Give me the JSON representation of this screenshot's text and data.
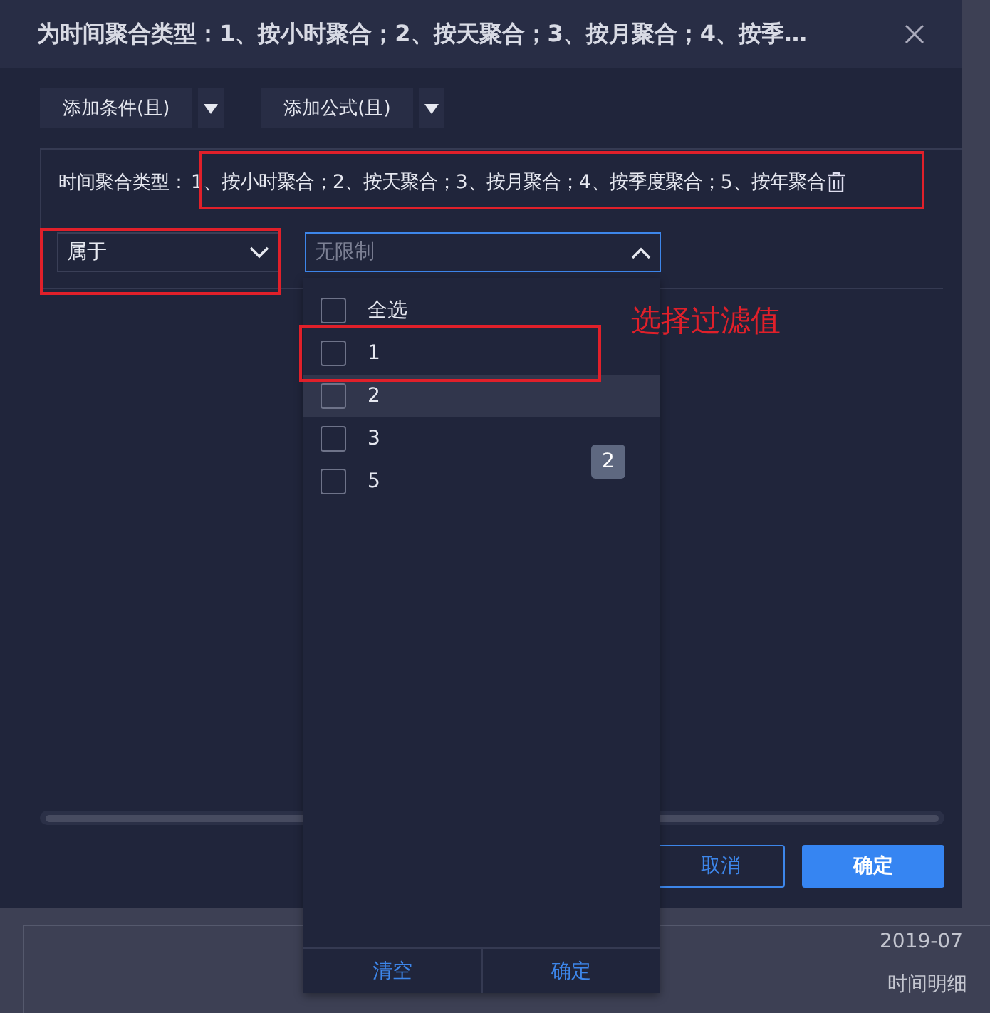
{
  "dialog": {
    "title": "为时间聚合类型：1、按小时聚合；2、按天聚合；3、按月聚合；4、按季…",
    "add_buttons": [
      {
        "label": "添加条件(且)"
      },
      {
        "label": "添加公式(且)"
      }
    ],
    "condition": {
      "label": "时间聚合类型：",
      "value": "1、按小时聚合；2、按天聚合；3、按月聚合；4、按季度聚合；5、按年聚合",
      "operator": "属于",
      "value_placeholder": "无限制",
      "expanded": true
    },
    "buttons": [
      {
        "label": "取消",
        "kind": "secondary"
      },
      {
        "label": "确定",
        "kind": "primary"
      }
    ]
  },
  "dropdown": {
    "options": [
      {
        "label": "全选",
        "checked": false,
        "highlighted": false
      },
      {
        "label": "1",
        "checked": false,
        "highlighted": false
      },
      {
        "label": "2",
        "checked": false,
        "highlighted": true
      },
      {
        "label": "3",
        "checked": false,
        "highlighted": false
      },
      {
        "label": "5",
        "checked": false,
        "highlighted": false
      }
    ],
    "badge": "2",
    "footer": [
      "清空",
      "确定"
    ]
  },
  "annotation": "选择过滤值",
  "background": {
    "date": "2019-07",
    "label": "时间明细"
  }
}
